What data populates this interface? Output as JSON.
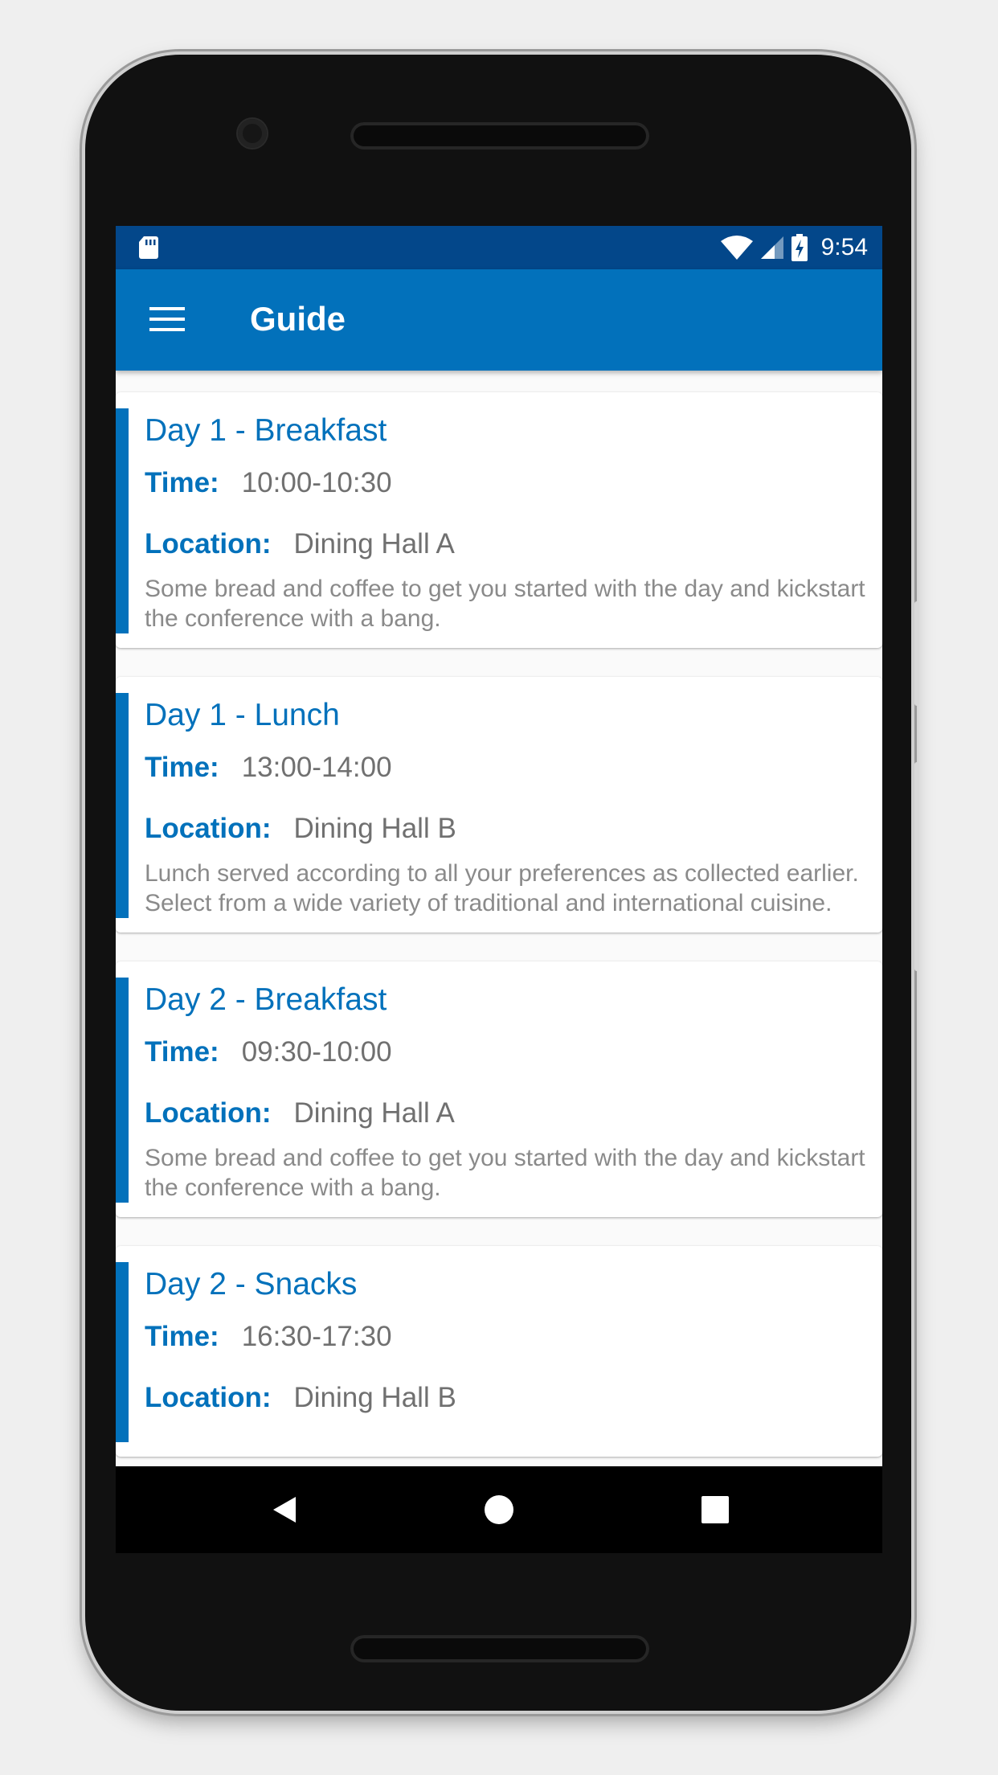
{
  "status_bar": {
    "time": "9:54",
    "icons": [
      "sd-card-icon",
      "wifi-icon",
      "signal-icon",
      "battery-charging-icon"
    ]
  },
  "app_bar": {
    "title": "Guide",
    "menu_icon": "hamburger-menu-icon"
  },
  "labels": {
    "time": "Time:",
    "location": "Location:"
  },
  "items": [
    {
      "title": "Day 1 - Breakfast",
      "time": "10:00-10:30",
      "location": "Dining Hall A",
      "description": "Some bread and coffee to get you started with the day and kickstart the conference with a bang."
    },
    {
      "title": "Day 1 - Lunch",
      "time": "13:00-14:00",
      "location": "Dining Hall B",
      "description": "Lunch served according to all your preferences as collected earlier. Select from a wide variety of traditional and international cuisine."
    },
    {
      "title": "Day 2 - Breakfast",
      "time": "09:30-10:00",
      "location": "Dining Hall A",
      "description": "Some bread and coffee to get you started with the day and kickstart the conference with a bang."
    },
    {
      "title": "Day 2 - Snacks",
      "time": "16:30-17:30",
      "location": "Dining Hall B",
      "description": ""
    }
  ],
  "nav": {
    "icons": [
      "back-icon",
      "home-icon",
      "recents-icon"
    ]
  },
  "colors": {
    "primary": "#0271bb",
    "status_bar": "#03478a",
    "value_text": "#707070",
    "description_text": "#8a8a8a"
  }
}
